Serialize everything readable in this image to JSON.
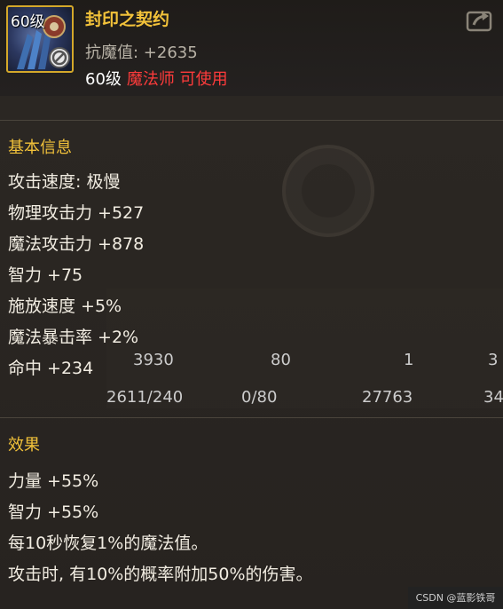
{
  "item": {
    "icon_level": "60级",
    "name": "封印之契约",
    "resist": "抗魔值: +2635",
    "requirement_level": "60级",
    "requirement_class": "魔法师 可使用"
  },
  "basic": {
    "title": "基本信息",
    "stats": [
      "攻击速度: 极慢",
      "物理攻击力 +527",
      "魔法攻击力 +878",
      "智力 +75",
      "施放速度 +5%",
      "魔法暴击率 +2%",
      "命中 +234"
    ]
  },
  "effect": {
    "title": "效果",
    "lines": [
      "力量 +55%",
      "智力 +55%",
      "每10秒恢复1%的魔法值。",
      "攻击时, 有10%的概率附加50%的伤害。"
    ]
  },
  "background_labels": [
    "3930",
    "80",
    "1",
    "3",
    "2611/240",
    "0/80",
    "27763",
    "34"
  ],
  "watermark": "CSDN @蓝影铁哥",
  "icons": {
    "share": "share-icon",
    "forbidden": "forbidden-icon"
  },
  "colors": {
    "title": "#f2c23a",
    "class_red": "#ff3b3b",
    "border_gold": "#d4a82a"
  }
}
